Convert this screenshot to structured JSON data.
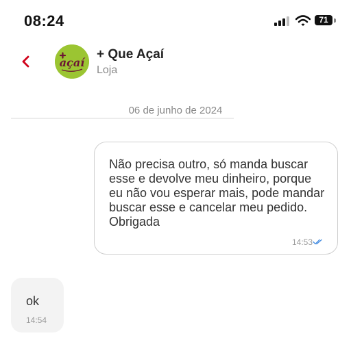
{
  "status_bar": {
    "time": "08:24",
    "battery": "71"
  },
  "header": {
    "store_name": "+ Que Açaí",
    "store_type": "Loja",
    "avatar_logo_text": "açaí"
  },
  "chat": {
    "date": "06 de junho de 2024",
    "messages": [
      {
        "direction": "outgoing",
        "text": "Não precisa outro, só manda buscar esse e devolve meu dinheiro, porque eu não vou esperar mais, pode mandar buscar esse e cancelar meu pedido. Obrigada",
        "time": "14:53",
        "status": "read"
      },
      {
        "direction": "incoming",
        "text": "ok",
        "time": "14:54"
      }
    ]
  },
  "colors": {
    "accent": "#d0021b",
    "avatar_bg": "#9bc532",
    "logo_text": "#6b1433",
    "read_check": "#4a90e2"
  }
}
